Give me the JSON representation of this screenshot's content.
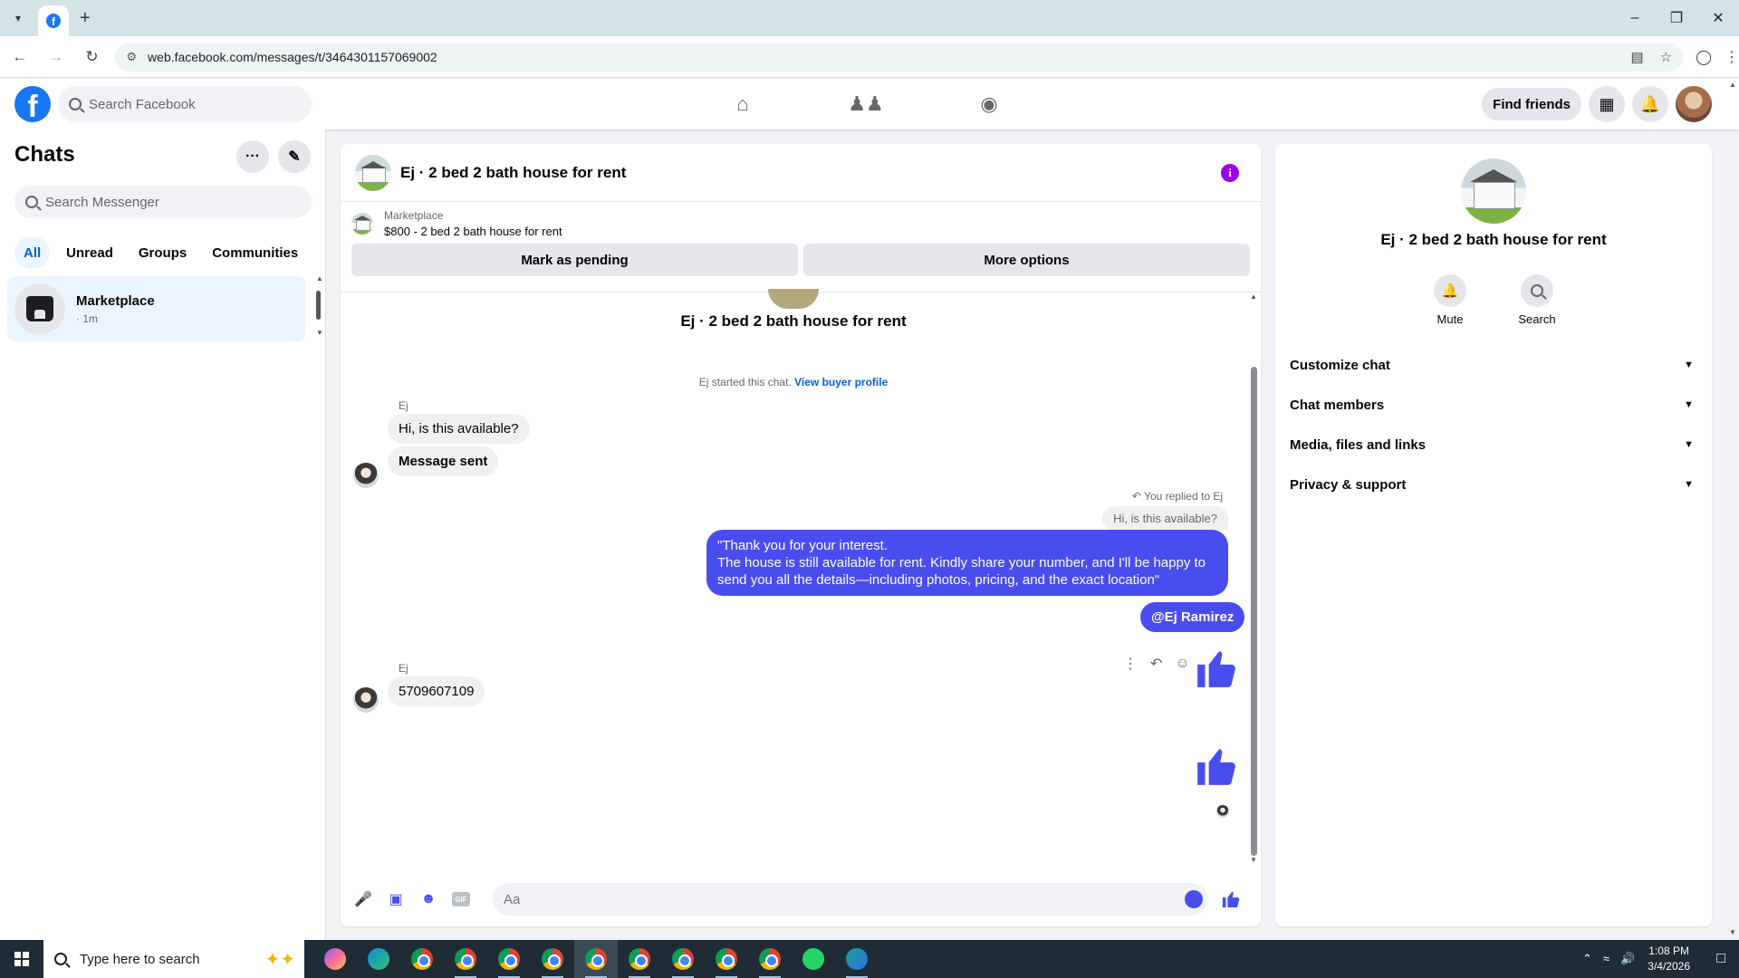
{
  "browser": {
    "url": "web.facebook.com/messages/t/3464301157069002",
    "tab_favicon": "f"
  },
  "fb": {
    "logo": "f",
    "search_placeholder": "Search Facebook",
    "nav_icons": [
      "home-icon",
      "friends-icon",
      "groups-icon"
    ],
    "find_friends": "Find friends"
  },
  "sidebar": {
    "title": "Chats",
    "search_placeholder": "Search Messenger",
    "filters": [
      "All",
      "Unread",
      "Groups",
      "Communities"
    ],
    "active_filter": "All",
    "chats": [
      {
        "name": "Marketplace",
        "time": "· 1m"
      }
    ]
  },
  "chat": {
    "title": "Ej · 2 bed 2 bath house for rent",
    "marketplace_label": "Marketplace",
    "listing": "$800 - 2 bed 2 bath house for rent",
    "mark_pending": "Mark as pending",
    "more_options": "More options",
    "conversation_title": "Ej · 2 bed 2 bath house for rent",
    "started_text": "Ej started this chat.",
    "buyer_profile_link": "View buyer profile",
    "messages": [
      {
        "sender": "Ej",
        "text": "Hi, is this available?"
      },
      {
        "text": "Message sent"
      },
      {
        "replied_label": "You replied to Ej",
        "quoted": "Hi, is this available?"
      },
      {
        "text_lines": [
          "\"Thank you for your interest.",
          "The house is still available for rent. Kindly share your number, and I'll be happy to",
          "send you all the details—including photos, pricing, and the exact location\""
        ]
      },
      {
        "text": "@Ej Ramirez"
      },
      {
        "sender": "Ej",
        "text": "5709607109"
      }
    ],
    "composer_placeholder": "Aa"
  },
  "details": {
    "title": "Ej · 2 bed 2 bath house for rent",
    "actions": [
      {
        "label": "Mute",
        "icon": "bell-icon"
      },
      {
        "label": "Search",
        "icon": "search-icon"
      }
    ],
    "sections": [
      "Customize chat",
      "Chat members",
      "Media, files and links",
      "Privacy & support"
    ]
  },
  "taskbar": {
    "search_text": "Type here to search",
    "time": "1:08 PM",
    "date": "3/4/2026"
  },
  "colors": {
    "accent": "#4a4ded",
    "fb_blue": "#1877f2",
    "info_purple": "#9b00e8"
  }
}
